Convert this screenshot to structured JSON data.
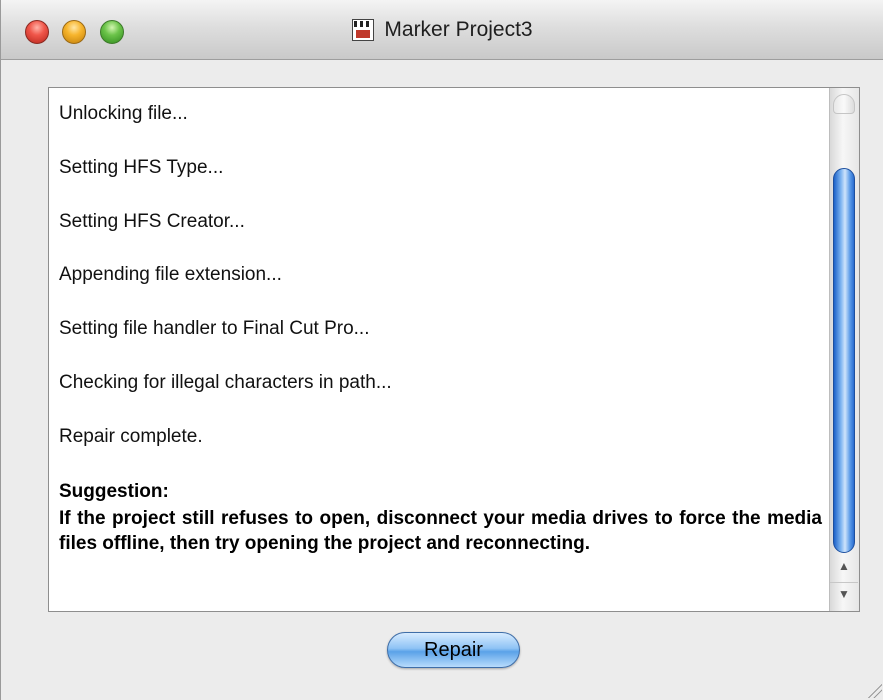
{
  "window": {
    "title": "Marker Project3",
    "title_icon": "final-cut-project-file-icon"
  },
  "traffic_lights": {
    "close_color": "#e9463b",
    "minimize_color": "#f3a929",
    "zoom_color": "#5bbd3a"
  },
  "log": {
    "lines": [
      "Unlocking file...",
      "Setting HFS Type...",
      "Setting HFS Creator...",
      "Appending file extension...",
      "Setting file handler to Final Cut Pro...",
      "Checking for illegal characters in path...",
      "Repair complete."
    ],
    "suggestion_title": "Suggestion:",
    "suggestion_text": "If the project still refuses to open, disconnect your media drives to force the media files offline, then try opening the project and reconnecting."
  },
  "buttons": {
    "repair_label": "Repair"
  },
  "colors": {
    "accent_blue": "#5aa2e8"
  }
}
